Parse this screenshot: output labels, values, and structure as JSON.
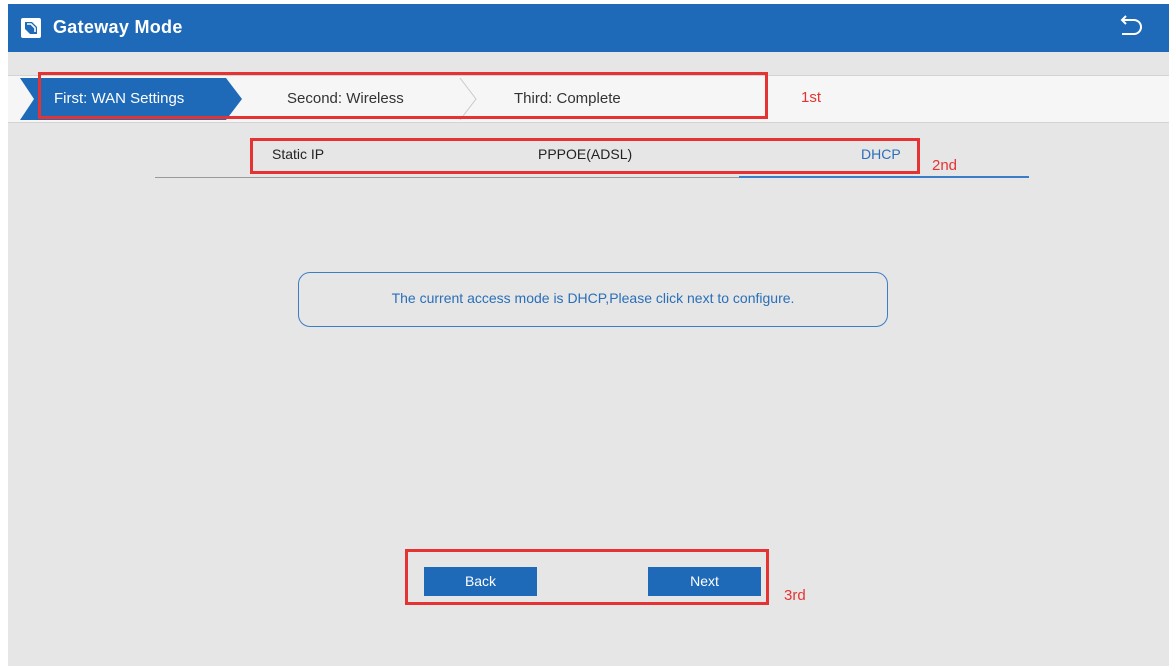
{
  "header": {
    "title": "Gateway Mode",
    "icons": {
      "logo": "router-logo-icon",
      "back": "return-arrow-icon"
    }
  },
  "steps": {
    "items": [
      {
        "label": "First: WAN Settings",
        "active": true
      },
      {
        "label": "Second: Wireless",
        "active": false
      },
      {
        "label": "Third: Complete",
        "active": false
      }
    ]
  },
  "mode_tabs": {
    "items": [
      {
        "label": "Static IP",
        "active": false
      },
      {
        "label": "PPPOE(ADSL)",
        "active": false
      },
      {
        "label": "DHCP",
        "active": true
      }
    ]
  },
  "message": "The current access mode is DHCP,Please click next to configure.",
  "buttons": {
    "back": "Back",
    "next": "Next"
  },
  "annotations": {
    "first": "1st",
    "second": "2nd",
    "third": "3rd"
  },
  "colors": {
    "header_bg": "#1e6ab8",
    "accent": "#2a6fb8",
    "annotation_red": "#e53333",
    "page_bg": "#e6e6e6"
  }
}
